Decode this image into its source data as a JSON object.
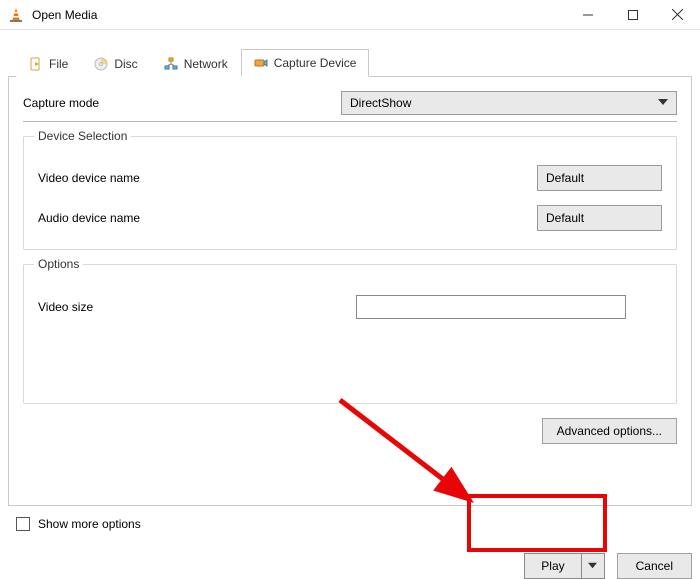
{
  "title": "Open Media",
  "tabs": {
    "file": "File",
    "disc": "Disc",
    "network": "Network",
    "capture": "Capture Device"
  },
  "capture_mode": {
    "label": "Capture mode",
    "value": "DirectShow"
  },
  "device_selection": {
    "legend": "Device Selection",
    "video_label": "Video device name",
    "video_value": "Default",
    "audio_label": "Audio device name",
    "audio_value": "Default"
  },
  "options": {
    "legend": "Options",
    "video_size_label": "Video size",
    "video_size_value": ""
  },
  "advanced_label": "Advanced options...",
  "show_more_label": "Show more options",
  "play_label": "Play",
  "cancel_label": "Cancel"
}
